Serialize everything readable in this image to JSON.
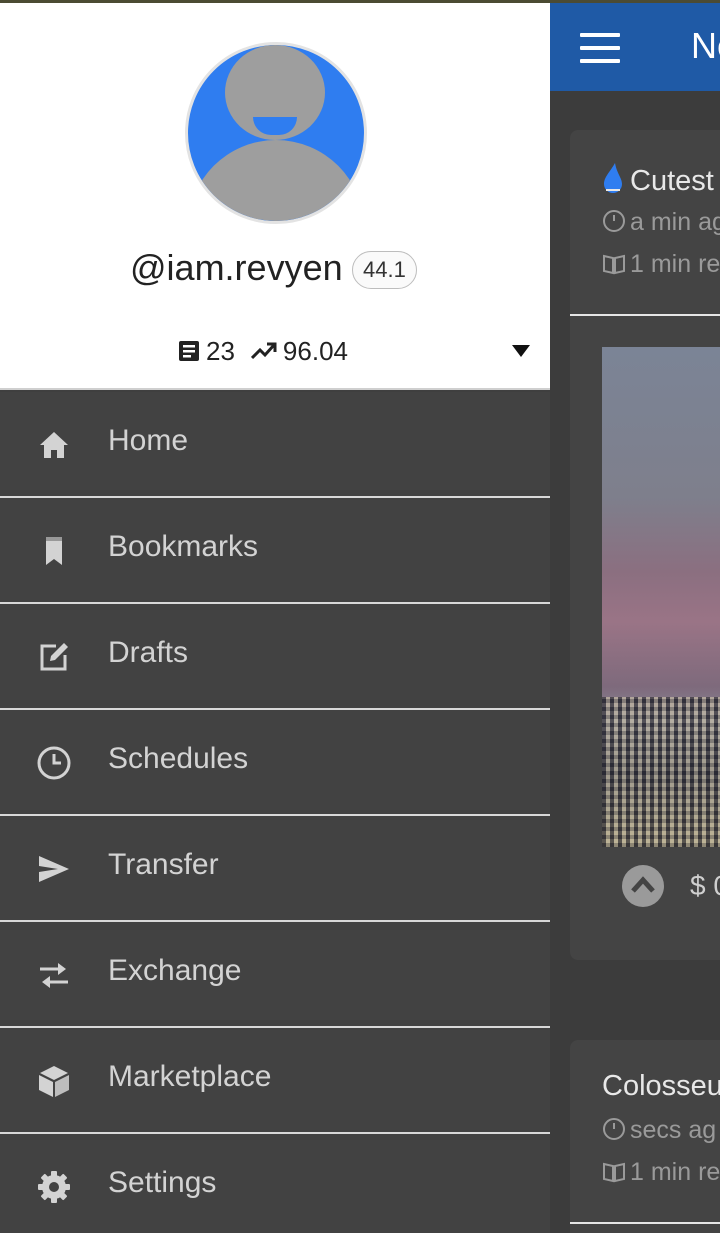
{
  "background": {
    "appbar": {
      "title": "Ne"
    },
    "cards": [
      {
        "title": "Cutest",
        "time": "a min ag",
        "read": "1 min re",
        "payout": "$ 0"
      },
      {
        "title": "Colosseu",
        "time": "secs ag",
        "read": "1 min re"
      }
    ]
  },
  "profile": {
    "username": "@iam.revyen",
    "reputation": "44.1",
    "posts": "23",
    "power": "96.04"
  },
  "menu": {
    "items": [
      {
        "label": "Home",
        "icon": "home-icon"
      },
      {
        "label": "Bookmarks",
        "icon": "bookmark-icon"
      },
      {
        "label": "Drafts",
        "icon": "edit-icon"
      },
      {
        "label": "Schedules",
        "icon": "clock-icon"
      },
      {
        "label": "Transfer",
        "icon": "send-icon"
      },
      {
        "label": "Exchange",
        "icon": "swap-icon"
      },
      {
        "label": "Marketplace",
        "icon": "cube-icon"
      },
      {
        "label": "Settings",
        "icon": "gear-icon"
      }
    ]
  },
  "colors": {
    "appbar": "#1f5aa6",
    "avatar_bg": "#2f7df0",
    "drawer_bg": "#424242",
    "menu_text": "#d3d3d3"
  }
}
